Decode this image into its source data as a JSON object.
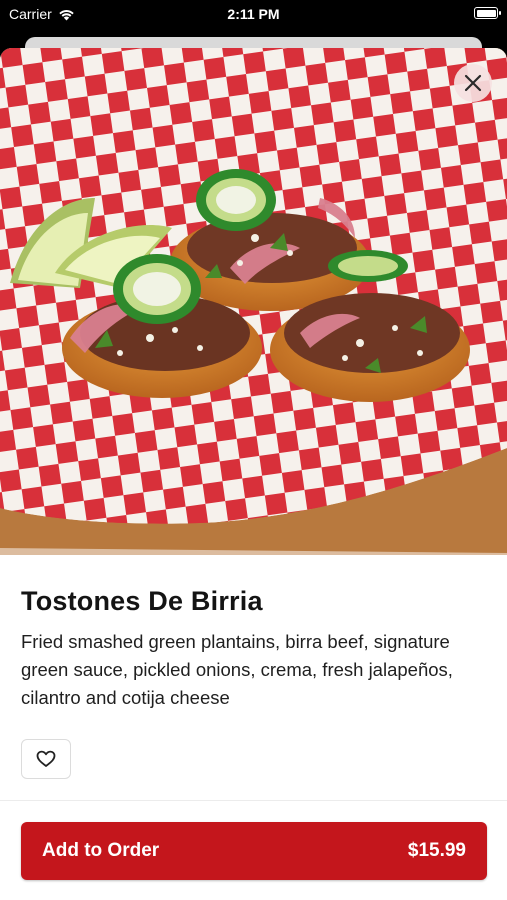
{
  "status_bar": {
    "carrier": "Carrier",
    "time": "2:11 PM"
  },
  "item": {
    "title": "Tostones De Birria",
    "description": "Fried smashed green plantains, birra beef, signature green sauce, pickled onions, crema, fresh jalapeños, cilantro and cotija cheese",
    "image_alt": "Tostones De Birria photo"
  },
  "order_button": {
    "label": "Add to Order",
    "price": "$15.99"
  },
  "icons": {
    "close": "close-icon",
    "favorite": "heart-icon",
    "wifi": "wifi-icon",
    "battery": "battery-icon"
  },
  "colors": {
    "accent": "#c4161c",
    "close_bg": "#f5e1e1"
  }
}
